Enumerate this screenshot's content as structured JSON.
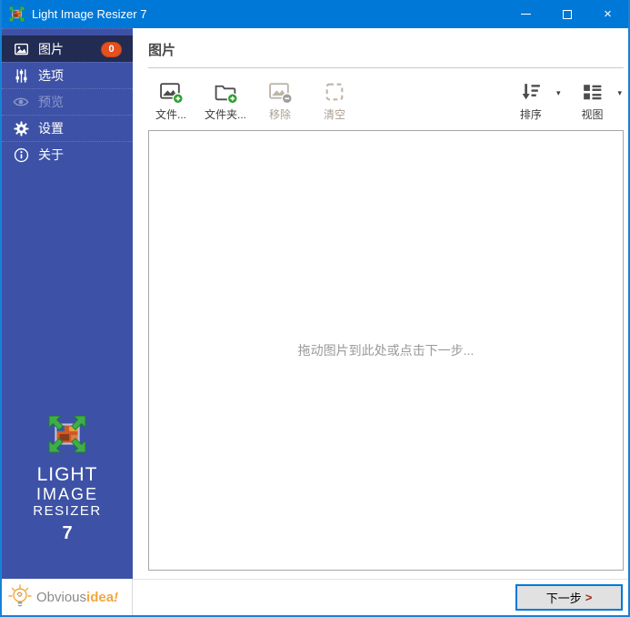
{
  "window": {
    "title": "Light Image Resizer 7",
    "controls": {
      "minimize": "minimize",
      "maximize": "maximize",
      "close": "×"
    }
  },
  "sidebar": {
    "items": [
      {
        "label": "图片",
        "icon": "pictures-icon",
        "badge": "0",
        "selected": true,
        "disabled": false
      },
      {
        "label": "选项",
        "icon": "options-icon",
        "selected": false,
        "disabled": false
      },
      {
        "label": "预览",
        "icon": "preview-icon",
        "selected": false,
        "disabled": true
      },
      {
        "label": "设置",
        "icon": "settings-icon",
        "selected": false,
        "disabled": false
      },
      {
        "label": "关于",
        "icon": "about-icon",
        "selected": false,
        "disabled": false
      }
    ],
    "logo": {
      "line1": "LIGHT",
      "line2": "IMAGE",
      "line3": "RESIZER",
      "version": "7"
    }
  },
  "header": {
    "title": "图片"
  },
  "toolbar": {
    "add_files_label": "文件...",
    "add_folder_label": "文件夹...",
    "remove_label": "移除",
    "clear_label": "清空",
    "sort_label": "排序",
    "view_label": "视图",
    "caret": "▾"
  },
  "dropzone": {
    "message": "拖动图片到此处或点击下一步..."
  },
  "footer": {
    "brand": {
      "part1": "Obvious",
      "part2": "idea",
      "part3": "!"
    },
    "next_button": {
      "label": "下一步",
      "arrow": ">"
    }
  },
  "colors": {
    "titlebar": "#0078d7",
    "sidebar": "#3d52a6",
    "sidebar_selected": "#222b52",
    "badge": "#e2511f",
    "brand_orange": "#f2a73d",
    "button_border": "#0078d7"
  }
}
